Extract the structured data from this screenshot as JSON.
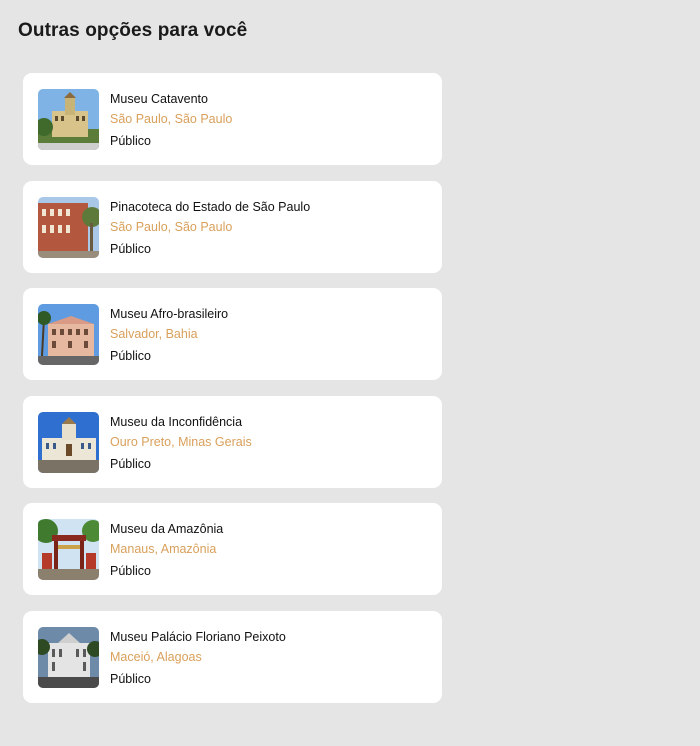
{
  "section": {
    "title": "Outras opções para você"
  },
  "colors": {
    "background": "#e5e5e5",
    "card": "#ffffff",
    "location": "#d9a05b"
  },
  "museums": [
    {
      "name": "Museu Catavento",
      "location": "São Paulo, São Paulo",
      "type": "Público",
      "image": "museum-photo"
    },
    {
      "name": "Pinacoteca do Estado de São Paulo",
      "location": "São Paulo, São Paulo",
      "type": "Público",
      "image": "museum-photo"
    },
    {
      "name": "Museu Afro-brasileiro",
      "location": "Salvador, Bahia",
      "type": "Público",
      "image": "museum-photo"
    },
    {
      "name": "Museu da Inconfidência",
      "location": "Ouro Preto, Minas Gerais",
      "type": "Público",
      "image": "museum-photo"
    },
    {
      "name": "Museu da Amazônia",
      "location": "Manaus, Amazônia",
      "type": "Público",
      "image": "museum-photo"
    },
    {
      "name": "Museu Palácio Floriano Peixoto",
      "location": "Maceió, Alagoas",
      "type": "Público",
      "image": "museum-photo"
    }
  ]
}
